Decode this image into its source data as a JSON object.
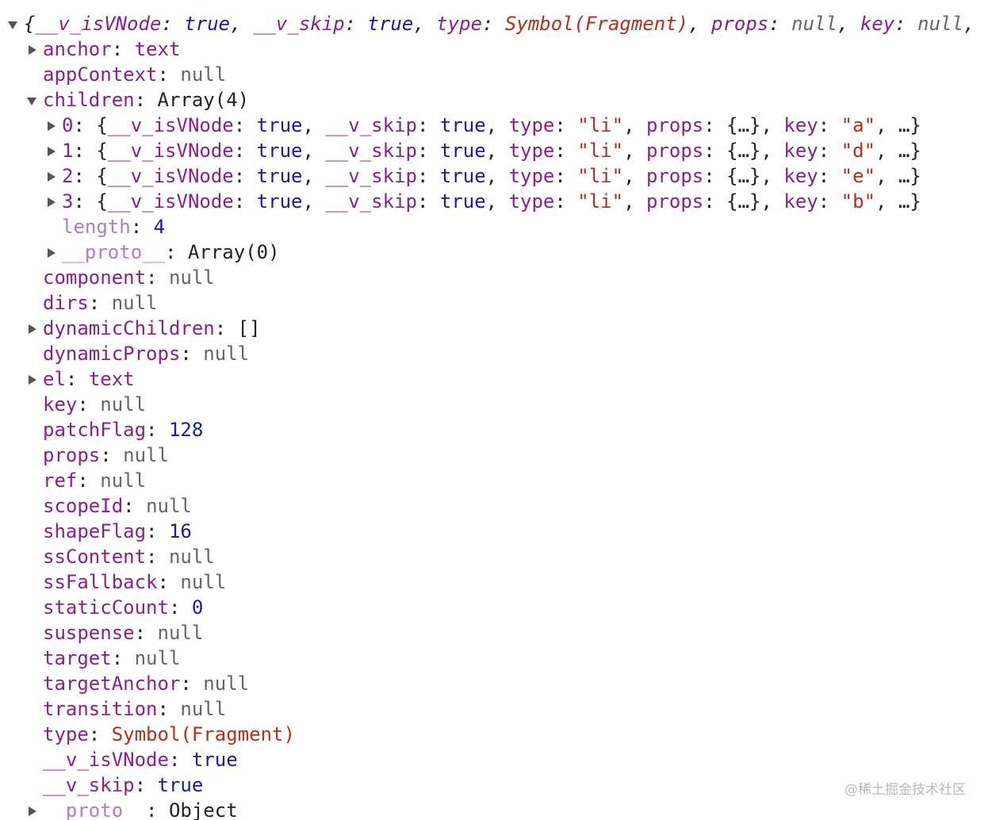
{
  "root": {
    "summary": {
      "open": "{",
      "k1": "__v_isVNode",
      "v1": "true",
      "k2": "__v_skip",
      "v2": "true",
      "k3": "type",
      "v3": "Symbol(Fragment)",
      "k4": "props",
      "v4": "null",
      "k5": "key",
      "v5": "null",
      "tail": ", ."
    }
  },
  "props": {
    "anchor": {
      "key": "anchor",
      "value": "text"
    },
    "appContext": {
      "key": "appContext",
      "value": "null"
    },
    "children": {
      "key": "children",
      "value": "Array(4)"
    },
    "component": {
      "key": "component",
      "value": "null"
    },
    "dirs": {
      "key": "dirs",
      "value": "null"
    },
    "dynamicChildren": {
      "key": "dynamicChildren",
      "value": "[]"
    },
    "dynamicProps": {
      "key": "dynamicProps",
      "value": "null"
    },
    "el": {
      "key": "el",
      "value": "text"
    },
    "key": {
      "key": "key",
      "value": "null"
    },
    "patchFlag": {
      "key": "patchFlag",
      "value": "128"
    },
    "props": {
      "key": "props",
      "value": "null"
    },
    "ref": {
      "key": "ref",
      "value": "null"
    },
    "scopeId": {
      "key": "scopeId",
      "value": "null"
    },
    "shapeFlag": {
      "key": "shapeFlag",
      "value": "16"
    },
    "ssContent": {
      "key": "ssContent",
      "value": "null"
    },
    "ssFallback": {
      "key": "ssFallback",
      "value": "null"
    },
    "staticCount": {
      "key": "staticCount",
      "value": "0"
    },
    "suspense": {
      "key": "suspense",
      "value": "null"
    },
    "target": {
      "key": "target",
      "value": "null"
    },
    "targetAnchor": {
      "key": "targetAnchor",
      "value": "null"
    },
    "transition": {
      "key": "transition",
      "value": "null"
    },
    "type": {
      "key": "type",
      "value": "Symbol(Fragment)"
    },
    "isVNode": {
      "key": "__v_isVNode",
      "value": "true"
    },
    "skip": {
      "key": "__v_skip",
      "value": "true"
    },
    "proto": {
      "key": "__proto__",
      "value": "Object"
    }
  },
  "children_items": [
    {
      "index": "0",
      "isVNode_key": "__v_isVNode",
      "isVNode_val": "true",
      "skip_key": "__v_skip",
      "skip_val": "true",
      "type_key": "type",
      "type_val": "\"li\"",
      "props_key": "props",
      "props_val": "{…}",
      "key_key": "key",
      "key_val": "\"a\"",
      "tail": "…}"
    },
    {
      "index": "1",
      "isVNode_key": "__v_isVNode",
      "isVNode_val": "true",
      "skip_key": "__v_skip",
      "skip_val": "true",
      "type_key": "type",
      "type_val": "\"li\"",
      "props_key": "props",
      "props_val": "{…}",
      "key_key": "key",
      "key_val": "\"d\"",
      "tail": "…}"
    },
    {
      "index": "2",
      "isVNode_key": "__v_isVNode",
      "isVNode_val": "true",
      "skip_key": "__v_skip",
      "skip_val": "true",
      "type_key": "type",
      "type_val": "\"li\"",
      "props_key": "props",
      "props_val": "{…}",
      "key_key": "key",
      "key_val": "\"e\"",
      "tail": "…}"
    },
    {
      "index": "3",
      "isVNode_key": "__v_isVNode",
      "isVNode_val": "true",
      "skip_key": "__v_skip",
      "skip_val": "true",
      "type_key": "type",
      "type_val": "\"li\"",
      "props_key": "props",
      "props_val": "{…}",
      "key_key": "key",
      "key_val": "\"b\"",
      "tail": "…}"
    }
  ],
  "children_meta": {
    "length": {
      "key": "length",
      "value": "4"
    },
    "proto": {
      "key": "__proto__",
      "value": "Array(0)"
    }
  },
  "watermark": "@稀土掘金技术社区",
  "colors": {
    "key": "#8a1f8f",
    "key_dim": "#b87bbd",
    "string": "#b5301a",
    "boolean": "#1a1aa6",
    "number": "#1a1aa6",
    "null": "#666666"
  }
}
